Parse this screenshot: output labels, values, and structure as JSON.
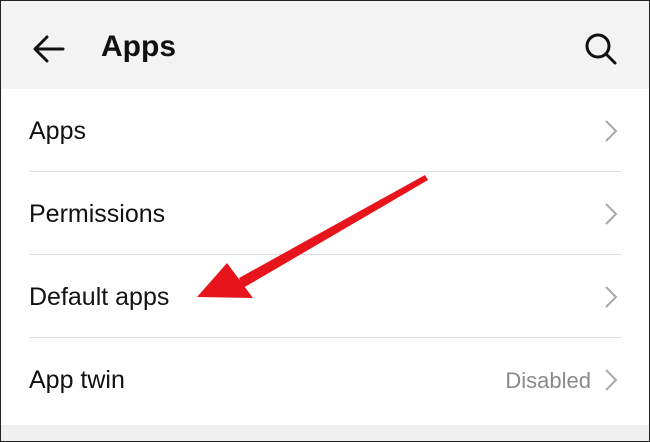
{
  "header": {
    "title": "Apps",
    "back_icon": "back-arrow-icon",
    "search_icon": "search-icon",
    "background": "#f3f3f3"
  },
  "menu": {
    "items": [
      {
        "label": "Apps",
        "value": ""
      },
      {
        "label": "Permissions",
        "value": ""
      },
      {
        "label": "Default apps",
        "value": ""
      },
      {
        "label": "App twin",
        "value": "Disabled"
      }
    ],
    "chevron_icon": "chevron-right-icon"
  },
  "annotation": {
    "icon": "red-arrow-annotation",
    "color": "#e8141b"
  }
}
